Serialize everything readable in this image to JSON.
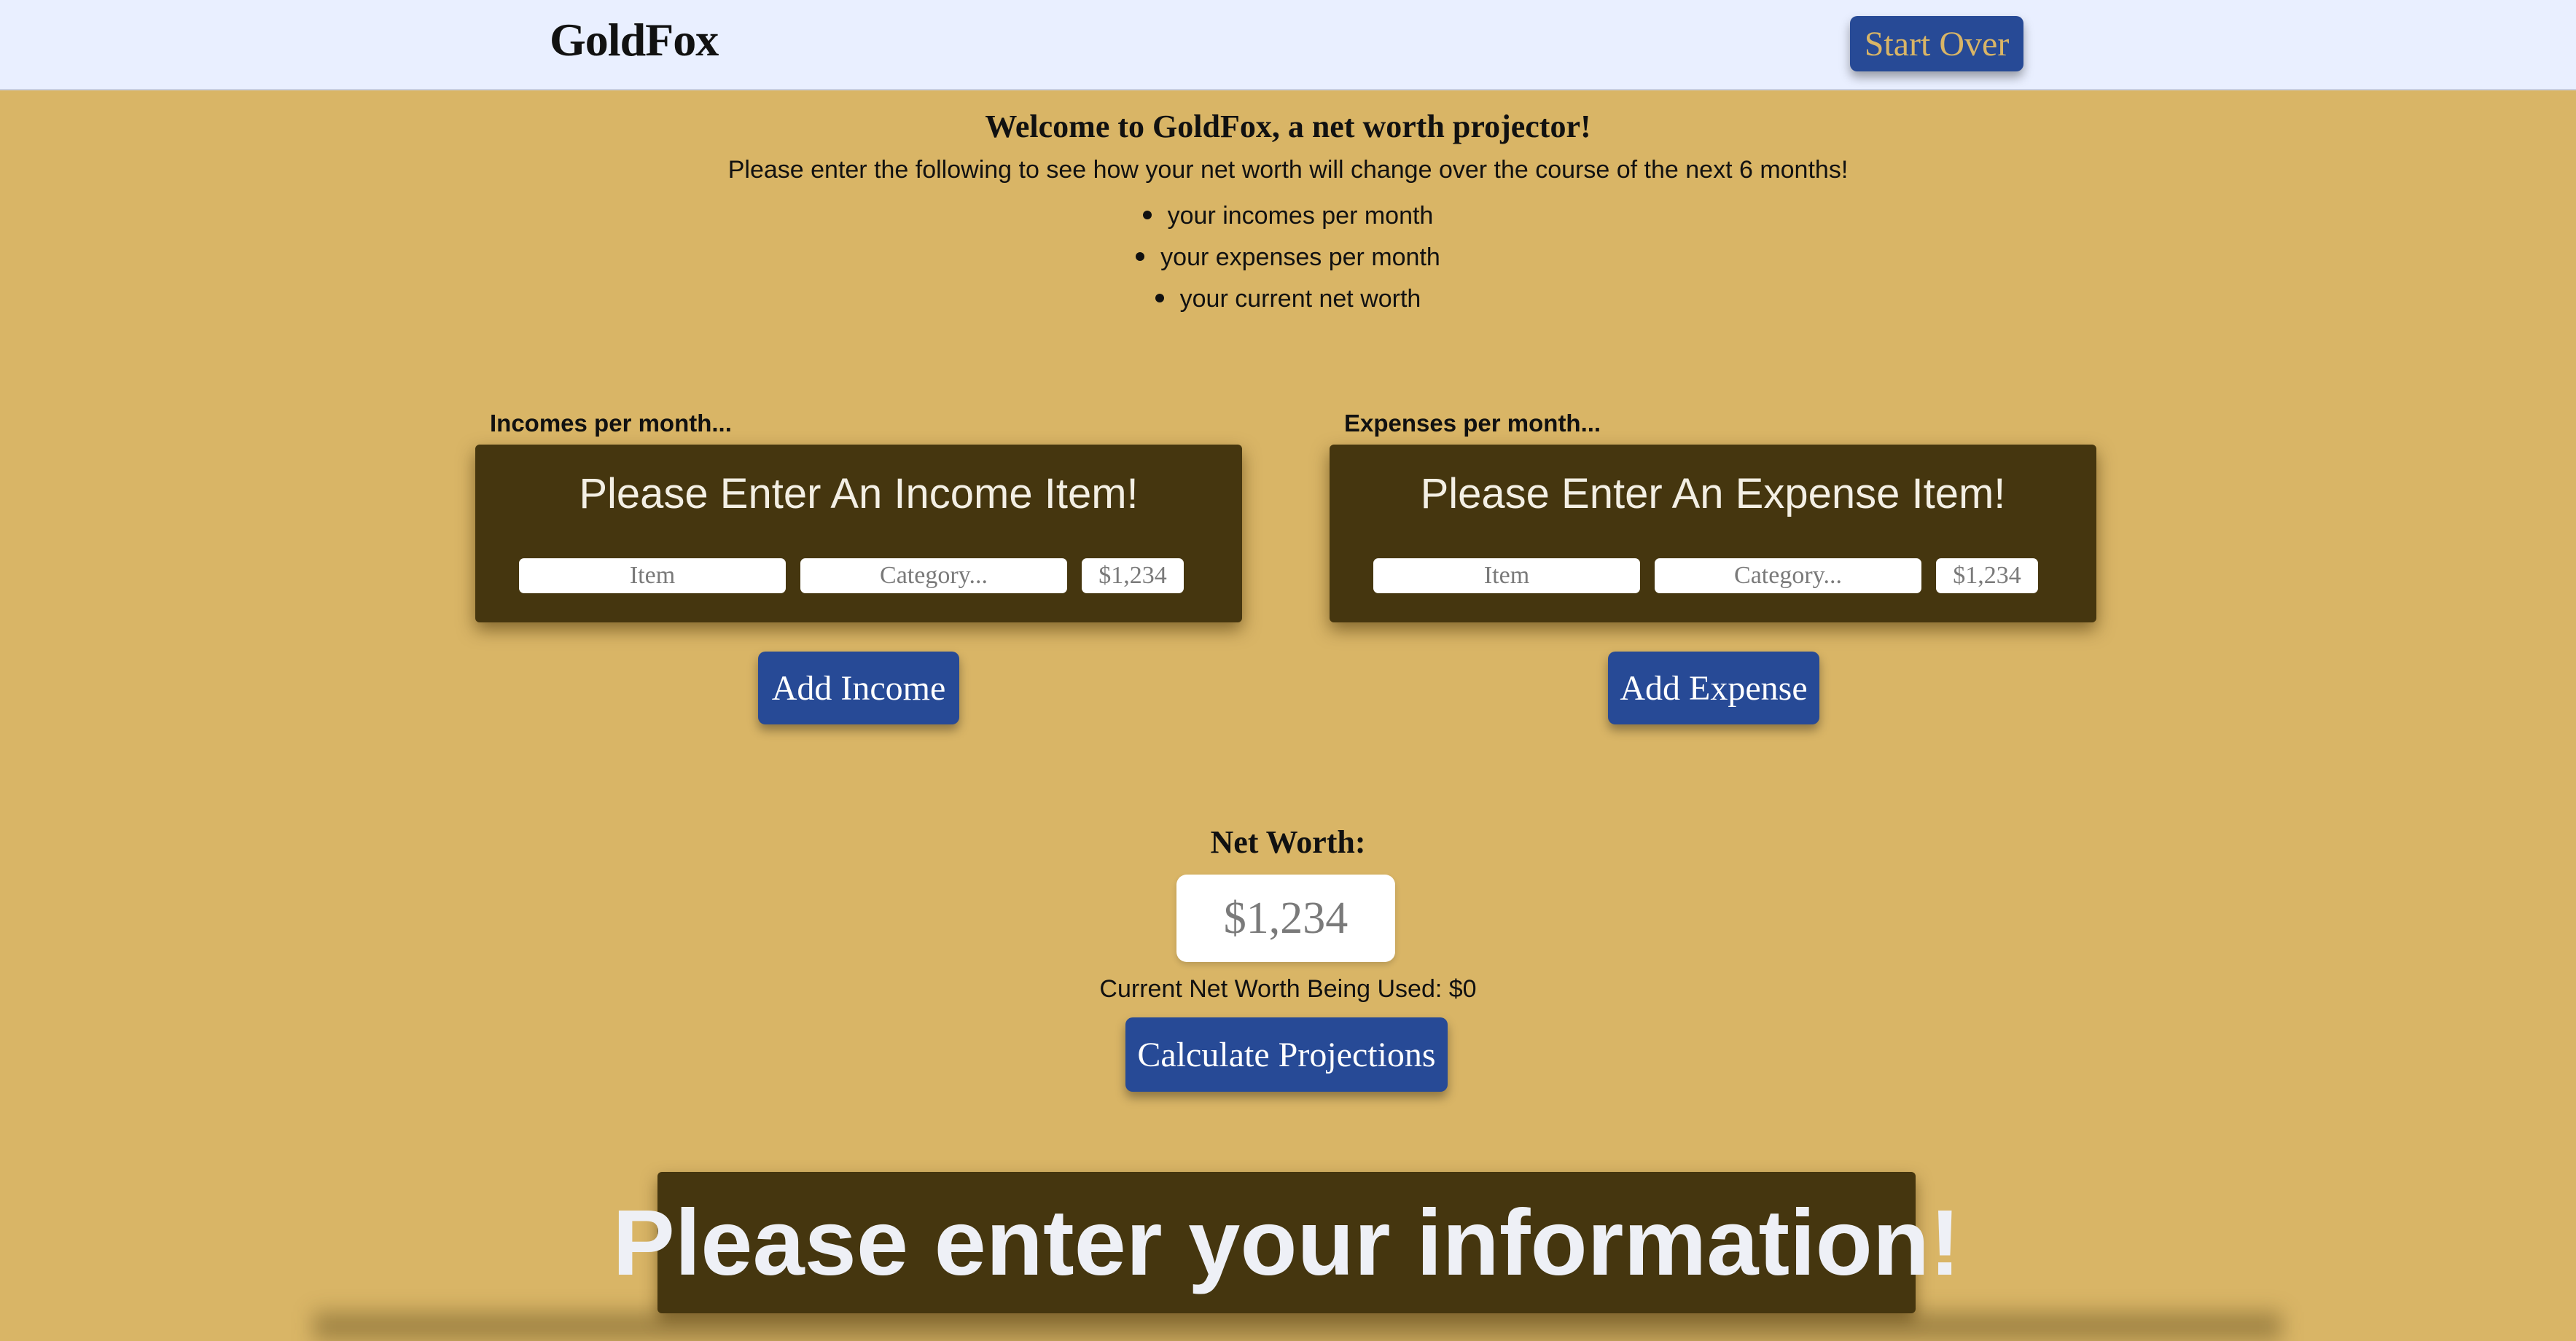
{
  "header": {
    "brand": "GoldFox",
    "start_over_label": "Start Over"
  },
  "intro": {
    "welcome": "Welcome to GoldFox, a net worth projector!",
    "instructions": "Please enter the following to see how your net worth will change over the course of the next 6 months!",
    "bullets": [
      "your incomes per month",
      "your expenses per month",
      "your current net worth"
    ]
  },
  "income": {
    "section_label": "Incomes per month...",
    "panel_title": "Please Enter An Income Item!",
    "item_placeholder": "Item",
    "category_placeholder": "Category...",
    "amount_placeholder": "$1,234",
    "add_label": "Add Income"
  },
  "expense": {
    "section_label": "Expenses per month...",
    "panel_title": "Please Enter An Expense Item!",
    "item_placeholder": "Item",
    "category_placeholder": "Category...",
    "amount_placeholder": "$1,234",
    "add_label": "Add Expense"
  },
  "net_worth": {
    "label": "Net Worth:",
    "placeholder": "$1,234",
    "current_text": "Current Net Worth Being Used: $0",
    "calculate_label": "Calculate Projections"
  },
  "banner": {
    "text": "Please enter your information!"
  },
  "colors": {
    "background": "#d9b566",
    "header": "#e9efff",
    "panel": "#45360f",
    "button": "#274a96"
  }
}
